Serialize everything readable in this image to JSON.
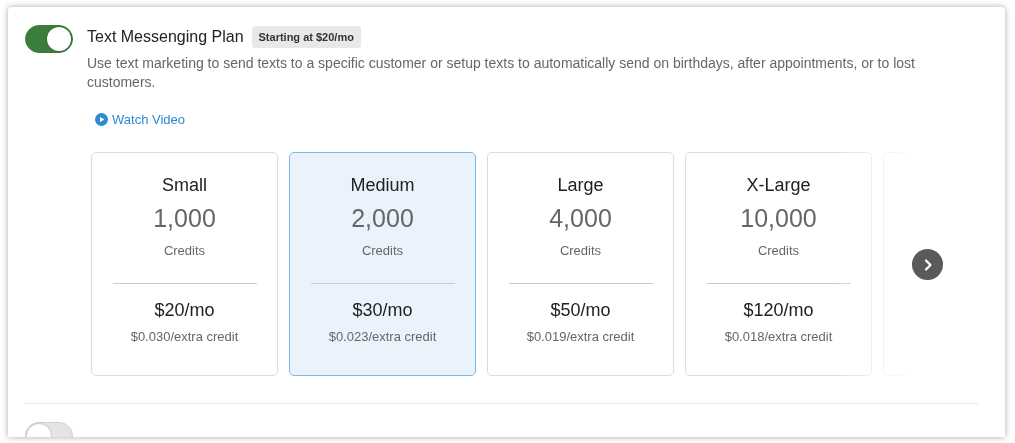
{
  "plans": [
    {
      "on": true,
      "title": "Text Messenging Plan",
      "badge": "Starting at $20/mo",
      "description": "Use text marketing to send texts to a specific customer or setup texts to automatically send on birthdays, after appointments, or to lost customers.",
      "video_link": "Watch Video",
      "tiers": [
        {
          "name": "Small",
          "credits": "1,000",
          "unit": "Credits",
          "price": "$20/mo",
          "extra": "$0.030/extra credit",
          "selected": false
        },
        {
          "name": "Medium",
          "credits": "2,000",
          "unit": "Credits",
          "price": "$30/mo",
          "extra": "$0.023/extra credit",
          "selected": true
        },
        {
          "name": "Large",
          "credits": "4,000",
          "unit": "Credits",
          "price": "$50/mo",
          "extra": "$0.019/extra credit",
          "selected": false
        },
        {
          "name": "X-Large",
          "credits": "10,000",
          "unit": "Credits",
          "price": "$120/mo",
          "extra": "$0.018/extra credit",
          "selected": false
        }
      ]
    },
    {
      "on": false
    }
  ]
}
